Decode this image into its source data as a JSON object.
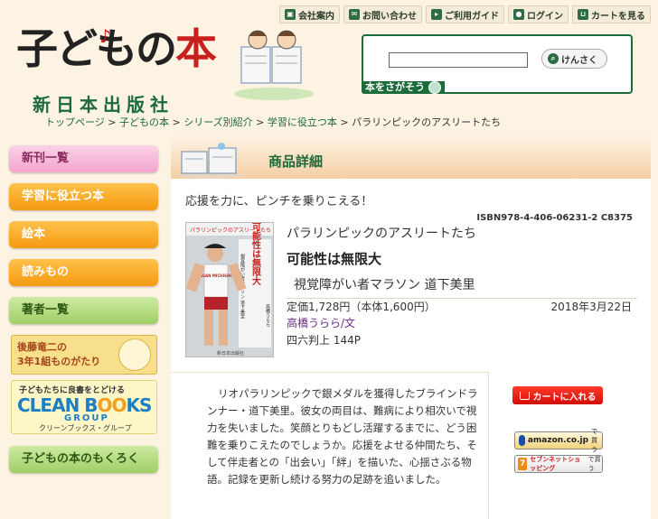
{
  "header": {
    "logo_title_a": "子ども",
    "logo_title_b": "の",
    "logo_title_c": "本",
    "publisher": "新日本出版社",
    "nav": [
      {
        "label": "会社案内",
        "icon": "building-icon"
      },
      {
        "label": "お問い合わせ",
        "icon": "mail-icon"
      },
      {
        "label": "ご利用ガイド",
        "icon": "guide-arrow-icon"
      },
      {
        "label": "ログイン",
        "icon": "person-icon"
      },
      {
        "label": "カートを見る",
        "icon": "cart-icon"
      }
    ],
    "search": {
      "button_label": "けんさく",
      "tab_label": "本をさがそう",
      "value": ""
    }
  },
  "breadcrumb": {
    "items": [
      "トップページ",
      "子どもの本",
      "シリーズ別紹介",
      "学習に役立つ本"
    ],
    "current": "パラリンピックのアスリートたち",
    "separator": " > "
  },
  "sidebar": {
    "items": [
      {
        "label": "新刊一覧",
        "style": "pink"
      },
      {
        "label": "学習に役立つ本",
        "style": "orange"
      },
      {
        "label": "絵本",
        "style": "orange"
      },
      {
        "label": "読みもの",
        "style": "orange"
      },
      {
        "label": "著者一覧",
        "style": "green"
      },
      {
        "label": "子どもの本のもくろく",
        "style": "green"
      }
    ],
    "banner_goto": {
      "line1": "後藤竜二の",
      "line2": "3年1組ものがたり"
    },
    "banner_clean": {
      "line1": "子どもたちに良書をとどける",
      "logo_a": "CLEAN B",
      "logo_o": "OO",
      "logo_b": "KS",
      "logo_group": "GROUP",
      "line4": "クリーンブックス・グループ"
    }
  },
  "main": {
    "section_title": "商品詳細",
    "catch": "応援を力に、ピンチを乗りこえる！",
    "isbn": "ISBN978-4-406-06231-2 C8375",
    "series": "パラリンピックのアスリートたち",
    "title": "可能性は無限大",
    "subtitle": "視覚障がい者マラソン 道下美里",
    "price": "定価1,728円（本体1,600円）",
    "date": "2018年3月22日",
    "author": "高橋うらら/文",
    "format": "四六判上 144P",
    "description": "リオパラリンピックで銀メダルを獲得したブラインドランナー・道下美里。彼女の両目は、難病により相次いで視力を失いました。笑顔とりもどし活躍するまでに、どう困難を乗りこえたのでしょうか。応援をよせる仲間たち、そして伴走者との「出会い」「絆」を描いた、心揺さぶる物語。記録を更新し続ける努力の足跡を追いました。",
    "cover": {
      "title_vertical": "可能性は無限大",
      "runner_bib": "NISSAN MICHISHITA",
      "series_label": "パラリンピックのアスリートたち",
      "subtitle_vertical": "視覚障がい者マラソン 道下美里",
      "name_vertical": "高橋うらら",
      "publisher": "新日本出版社"
    },
    "cart_button": "カートに入れる",
    "amazon_button": {
      "label": "amazon.co.jp",
      "suffix": "で買う"
    },
    "seven_button": {
      "logo": "7",
      "label": "セブンネットショッピング",
      "suffix": "で買う"
    }
  },
  "colors": {
    "brand_green": "#1d6a3b",
    "brand_red": "#c8201c",
    "background": "#fdf3e3",
    "author_purple": "#6a2a8a"
  }
}
